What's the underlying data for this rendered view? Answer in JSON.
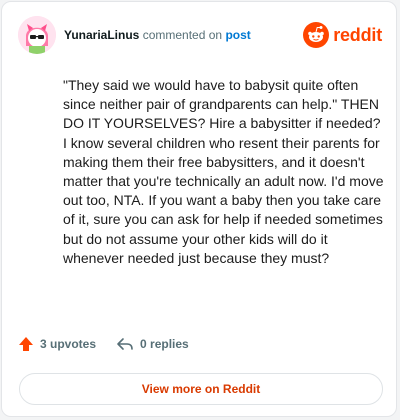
{
  "comment": {
    "username": "YunariaLinus",
    "action_text": "commented on",
    "post_link": "post",
    "body": "\"They said we would have to babysit quite often since neither pair of grandparents can help.\" THEN DO IT YOURSELVES? Hire a babysitter if needed? I know several children who resent their parents for making them their free babysitters, and it doesn't matter that you're technically an adult now. I'd move out too, NTA. If you want a baby then you take care of it, sure you can ask for help if needed sometimes but do not assume your other kids will do it whenever needed just because they must?",
    "upvotes": "3 upvotes",
    "replies": "0 replies"
  },
  "brand": {
    "logo_text": "reddit",
    "color": "#ff4500"
  },
  "footer": {
    "view_more_label": "View more on Reddit"
  },
  "icons": {
    "avatar": "avatar",
    "logo": "reddit-logo-icon",
    "upvote": "upvote-arrow-icon",
    "reply": "reply-arrow-icon"
  }
}
